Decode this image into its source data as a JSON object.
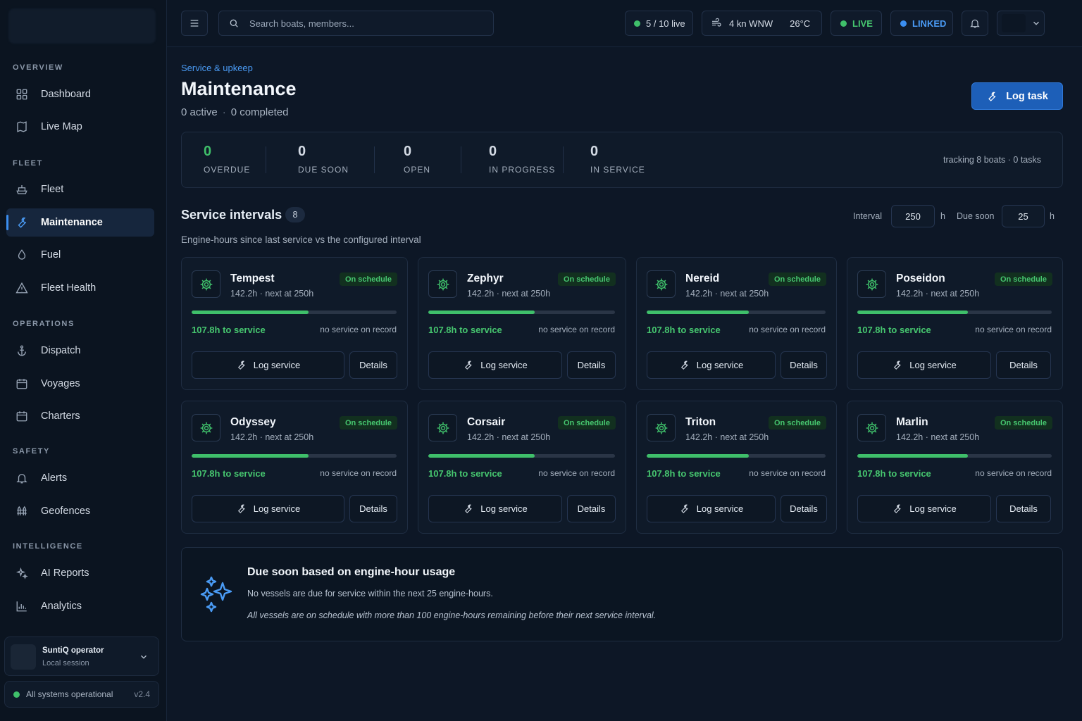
{
  "sidebar": {
    "sections": [
      {
        "title": "OVERVIEW"
      },
      {
        "title": "FLEET"
      },
      {
        "title": "OPERATIONS"
      },
      {
        "title": "SAFETY"
      },
      {
        "title": "INTELLIGENCE"
      }
    ],
    "items": [
      {
        "label": "Dashboard",
        "icon": "grid-icon"
      },
      {
        "label": "Live Map",
        "icon": "map-icon"
      },
      {
        "label": "Fleet",
        "icon": "boat-icon"
      },
      {
        "label": "Maintenance",
        "icon": "wrench-icon",
        "active": true
      },
      {
        "label": "Fuel",
        "icon": "droplet-icon"
      },
      {
        "label": "Fleet Health",
        "icon": "warning-icon"
      },
      {
        "label": "Dispatch",
        "icon": "anchor-icon"
      },
      {
        "label": "Voyages",
        "icon": "calendar-icon"
      },
      {
        "label": "Charters",
        "icon": "calendar-icon"
      },
      {
        "label": "Alerts",
        "icon": "bell-icon"
      },
      {
        "label": "Geofences",
        "icon": "fence-icon"
      },
      {
        "label": "AI Reports",
        "icon": "sparkle-icon"
      },
      {
        "label": "Analytics",
        "icon": "chart-icon"
      }
    ],
    "operator": {
      "name": "SuntiQ operator",
      "session": "Local session"
    },
    "status": {
      "text": "All systems operational",
      "version": "v2.4"
    }
  },
  "topbar": {
    "search_placeholder": "Search boats, members...",
    "live_count": "5 / 10 live",
    "wind": "4 kn WNW",
    "temperature": "26°C",
    "live_label": "LIVE",
    "linked_label": "LINKED"
  },
  "page": {
    "breadcrumb": "Service & upkeep",
    "title": "Maintenance",
    "active": "0 active",
    "completed": "0 completed",
    "log_task_label": "Log task"
  },
  "stats": [
    {
      "value": "0",
      "label": "OVERDUE"
    },
    {
      "value": "0",
      "label": "DUE SOON"
    },
    {
      "value": "0",
      "label": "OPEN"
    },
    {
      "value": "0",
      "label": "IN PROGRESS"
    },
    {
      "value": "0",
      "label": "IN SERVICE"
    }
  ],
  "tracking": "tracking 8 boats · 0 tasks",
  "intervals": {
    "title": "Service intervals",
    "count": "8",
    "description": "Engine-hours since last service vs the configured interval",
    "interval_label": "Interval",
    "interval_value": "250",
    "interval_unit": "h",
    "due_soon_label": "Due soon",
    "due_soon_value": "25",
    "due_soon_unit": "h"
  },
  "card_labels": {
    "log_service": "Log service",
    "details": "Details"
  },
  "boats": [
    {
      "name": "Tempest",
      "meta": "142.2h · next at 250h",
      "status": "On schedule",
      "remaining": "107.8h to service",
      "record": "no service on record",
      "progress": 0.569
    },
    {
      "name": "Zephyr",
      "meta": "142.2h · next at 250h",
      "status": "On schedule",
      "remaining": "107.8h to service",
      "record": "no service on record",
      "progress": 0.569
    },
    {
      "name": "Nereid",
      "meta": "142.2h · next at 250h",
      "status": "On schedule",
      "remaining": "107.8h to service",
      "record": "no service on record",
      "progress": 0.569
    },
    {
      "name": "Poseidon",
      "meta": "142.2h · next at 250h",
      "status": "On schedule",
      "remaining": "107.8h to service",
      "record": "no service on record",
      "progress": 0.569
    },
    {
      "name": "Odyssey",
      "meta": "142.2h · next at 250h",
      "status": "On schedule",
      "remaining": "107.8h to service",
      "record": "no service on record",
      "progress": 0.569
    },
    {
      "name": "Corsair",
      "meta": "142.2h · next at 250h",
      "status": "On schedule",
      "remaining": "107.8h to service",
      "record": "no service on record",
      "progress": 0.569
    },
    {
      "name": "Triton",
      "meta": "142.2h · next at 250h",
      "status": "On schedule",
      "remaining": "107.8h to service",
      "record": "no service on record",
      "progress": 0.569
    },
    {
      "name": "Marlin",
      "meta": "142.2h · next at 250h",
      "status": "On schedule",
      "remaining": "107.8h to service",
      "record": "no service on record",
      "progress": 0.569
    }
  ],
  "due_soon": {
    "title": "Due soon based on engine-hour usage",
    "line1": "No vessels are due for service within the next 25 engine-hours.",
    "line2": "All vessels are on schedule with more than 100 engine-hours remaining before their next service interval."
  },
  "colors": {
    "accent": "#3b8ef0",
    "success": "#3fbf6a",
    "background": "#0d1726"
  }
}
